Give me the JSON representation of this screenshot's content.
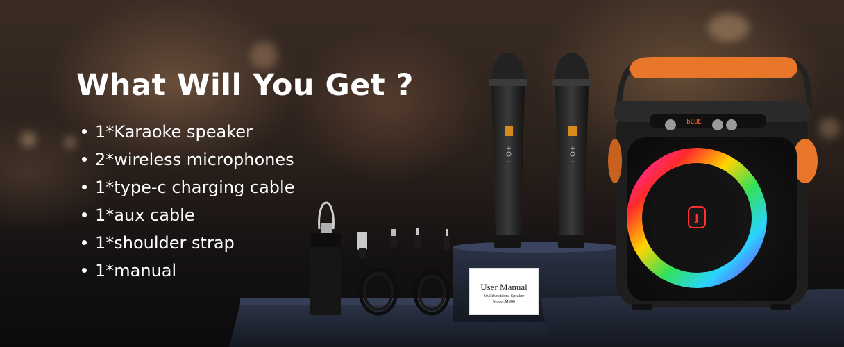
{
  "banner": {
    "headline": "What Will You Get ?",
    "items": [
      "1*Karaoke speaker",
      "2*wireless microphones",
      "1*type-c charging cable",
      "1*aux cable",
      "1*shoulder strap",
      "1*manual"
    ]
  },
  "manual": {
    "title": "User Manual",
    "subtitle": "Multifunctional Speaker",
    "model": "Model:MS80"
  },
  "speaker": {
    "display_text": "bLUE",
    "brand_mark": "J"
  },
  "colors": {
    "handle": "#e8772a",
    "body": "#1e1e1e",
    "ring": [
      "#ff2a2a",
      "#ffd400",
      "#33e05a",
      "#2ad4ff",
      "#7a3cff",
      "#ff2ab8"
    ]
  }
}
